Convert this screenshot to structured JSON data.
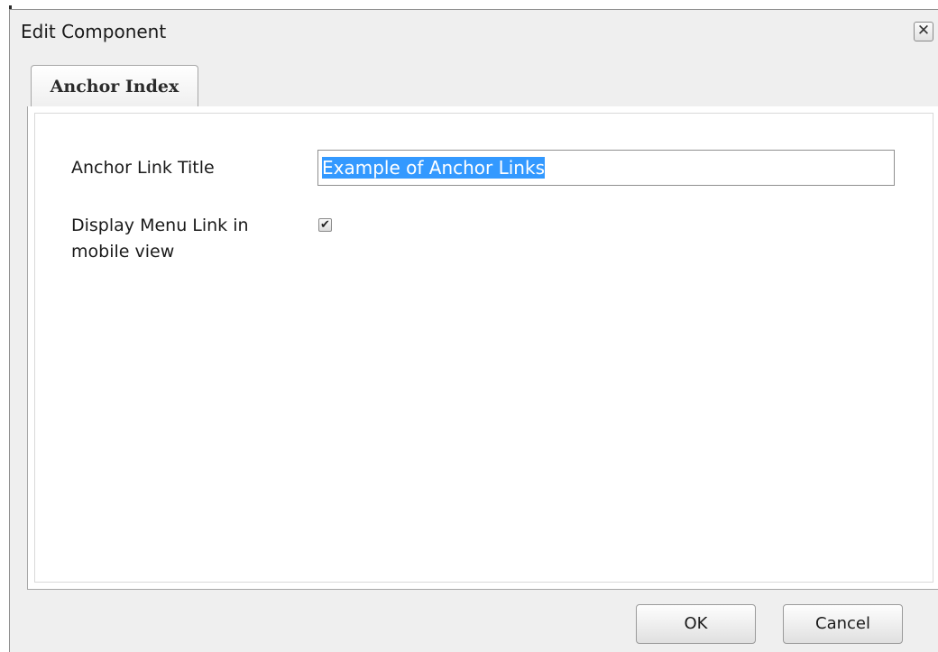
{
  "dialog": {
    "title": "Edit Component",
    "close_glyph": "✕",
    "close_icon": "close-icon"
  },
  "tabs": [
    {
      "label": "Anchor Index",
      "active": true
    }
  ],
  "form": {
    "anchor_title": {
      "label": "Anchor Link Title",
      "value": "Example of Anchor Links"
    },
    "mobile_menu": {
      "label": "Display Menu Link in mobile view",
      "checked": true,
      "check_glyph": "✔"
    }
  },
  "buttons": {
    "ok_label": "OK",
    "cancel_label": "Cancel"
  },
  "colors": {
    "selection": "#3399ff",
    "dialog_bg": "#efefef"
  }
}
